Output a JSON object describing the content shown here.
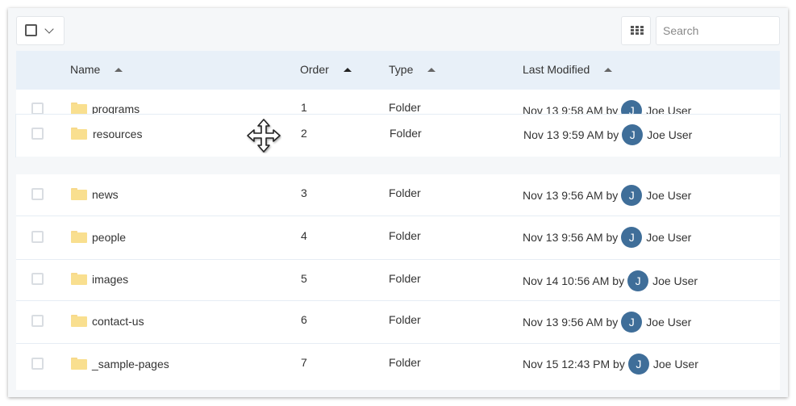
{
  "toolbar": {
    "bulk_select_icon": "checkbox-icon",
    "bulk_select_menu_icon": "chevron-down-icon",
    "grid_view_icon": "grid-icon",
    "search_placeholder": "Search",
    "search_value": ""
  },
  "table": {
    "columns": [
      {
        "label": "Name",
        "sort": "ascending"
      },
      {
        "label": "Order",
        "sort": "ascending-active"
      },
      {
        "label": "Type",
        "sort": "ascending"
      },
      {
        "label": "Last Modified",
        "sort": "ascending"
      }
    ],
    "rows": [
      {
        "name": "programs",
        "order": "1",
        "type": "Folder",
        "modified": "Nov 13 9:58 AM by",
        "avatar": "J",
        "user": "Joe User"
      },
      {
        "name": "resources",
        "order": "2",
        "type": "Folder",
        "modified": "Nov 13 9:59 AM by",
        "avatar": "J",
        "user": "Joe User",
        "dragging": true
      },
      {
        "name": "news",
        "order": "3",
        "type": "Folder",
        "modified": "Nov 13 9:56 AM by",
        "avatar": "J",
        "user": "Joe User"
      },
      {
        "name": "people",
        "order": "4",
        "type": "Folder",
        "modified": "Nov 13 9:56 AM by",
        "avatar": "J",
        "user": "Joe User"
      },
      {
        "name": "images",
        "order": "5",
        "type": "Folder",
        "modified": "Nov 14 10:56 AM by",
        "avatar": "J",
        "user": "Joe User"
      },
      {
        "name": "contact-us",
        "order": "6",
        "type": "Folder",
        "modified": "Nov 13 9:56 AM by",
        "avatar": "J",
        "user": "Joe User"
      },
      {
        "name": "_sample-pages",
        "order": "7",
        "type": "Folder",
        "modified": "Nov 15 12:43 PM by",
        "avatar": "J",
        "user": "Joe User"
      }
    ]
  },
  "cursor": {
    "icon": "move-cursor-icon"
  },
  "colors": {
    "header_bg": "#e8f0f8",
    "panel_bg": "#f5f7f9",
    "avatar_bg": "#3f6e99",
    "folder": "#f9df8f"
  }
}
